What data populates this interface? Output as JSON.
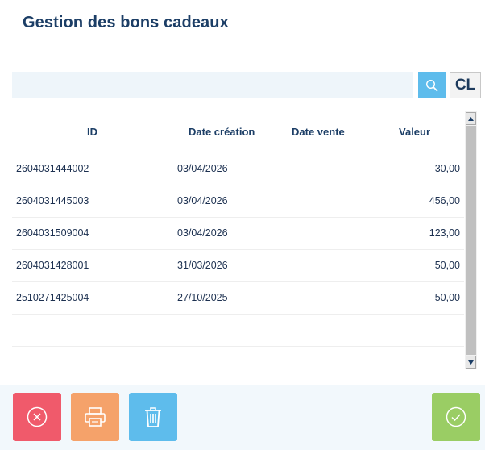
{
  "header": {
    "title": "Gestion des bons cadeaux"
  },
  "search": {
    "value": "",
    "placeholder": "",
    "search_icon": "search-icon",
    "clear_label": "CL"
  },
  "table": {
    "columns": [
      "ID",
      "Date création",
      "Date vente",
      "Valeur"
    ],
    "rows": [
      {
        "id": "2604031444002",
        "created": "03/04/2026",
        "sold": "",
        "value": "30,00"
      },
      {
        "id": "2604031445003",
        "created": "03/04/2026",
        "sold": "",
        "value": "456,00"
      },
      {
        "id": "2604031509004",
        "created": "03/04/2026",
        "sold": "",
        "value": "123,00"
      },
      {
        "id": "2604031428001",
        "created": "31/03/2026",
        "sold": "",
        "value": "50,00"
      },
      {
        "id": "2510271425004",
        "created": "27/10/2025",
        "sold": "",
        "value": "50,00"
      }
    ]
  },
  "footer": {
    "buttons": [
      {
        "name": "cancel",
        "icon": "close-circle-icon",
        "color": "#f05a6b"
      },
      {
        "name": "print",
        "icon": "printer-icon",
        "color": "#f5a26a"
      },
      {
        "name": "delete",
        "icon": "trash-icon",
        "color": "#5ebcec"
      },
      {
        "name": "confirm",
        "icon": "check-circle-icon",
        "color": "#9acd64"
      }
    ]
  },
  "colors": {
    "accent": "#5ebcec",
    "title": "#1c3e66",
    "search_bg": "#eef5fa",
    "footer_bg": "#f2f8fc"
  }
}
